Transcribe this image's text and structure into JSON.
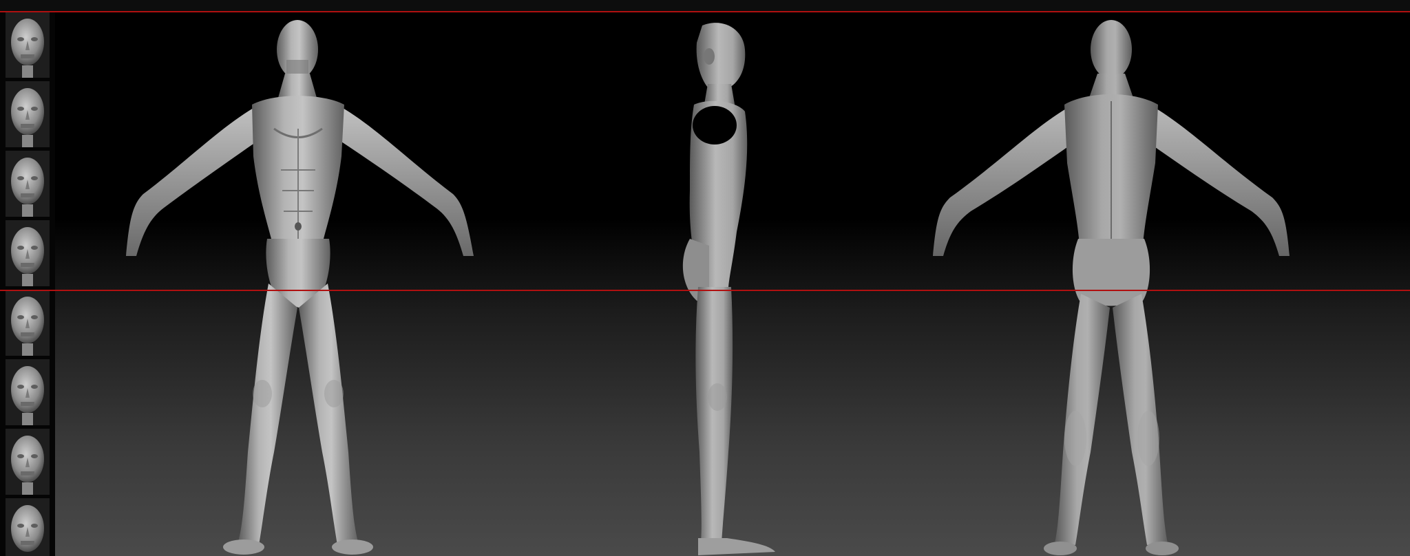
{
  "app": {
    "colors": {
      "guide": "#b01010",
      "clay_light": "#bcbcbc",
      "clay_mid": "#8f8f8f",
      "clay_dark": "#5a5a5a",
      "background_top": "#000000",
      "background_bottom": "#4a4a4a"
    }
  },
  "thumbnails": {
    "items": [
      {
        "icon": "head-thumbnail-icon"
      },
      {
        "icon": "head-thumbnail-icon"
      },
      {
        "icon": "head-thumbnail-icon"
      },
      {
        "icon": "head-thumbnail-icon"
      },
      {
        "icon": "head-thumbnail-icon"
      },
      {
        "icon": "head-thumbnail-icon"
      },
      {
        "icon": "head-thumbnail-icon"
      },
      {
        "icon": "head-thumbnail-icon"
      }
    ]
  },
  "viewport": {
    "views": [
      {
        "icon": "front-view-figure"
      },
      {
        "icon": "side-view-figure"
      },
      {
        "icon": "back-view-figure"
      }
    ],
    "guides": [
      {
        "icon": "top-guide-line"
      },
      {
        "icon": "crotch-guide-line"
      }
    ]
  }
}
